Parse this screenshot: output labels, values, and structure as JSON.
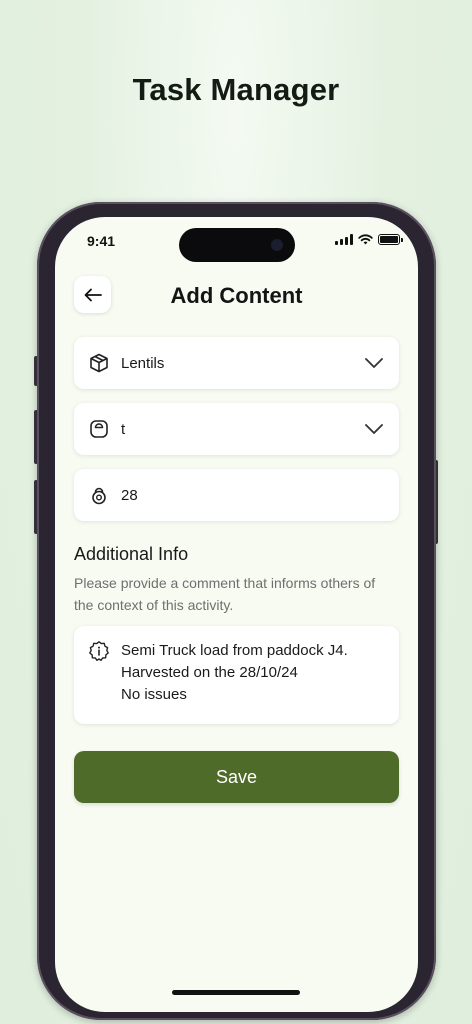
{
  "promo": {
    "title": "Task Manager"
  },
  "status_bar": {
    "time": "9:41"
  },
  "header": {
    "title": "Add Content",
    "back_icon": "arrow-left-icon"
  },
  "form": {
    "crop": {
      "icon": "box-icon",
      "value": "Lentils"
    },
    "unit": {
      "icon": "weight-icon",
      "value": "t"
    },
    "quantity": {
      "icon": "kettlebell-icon",
      "value": "28"
    }
  },
  "additional_info": {
    "title": "Additional Info",
    "subtitle": "Please provide a comment that informs others of the context of this activity.",
    "comment_lines": [
      "Semi Truck load from paddock J4.",
      "Harvested on the 28/10/24",
      "No issues"
    ],
    "comment_icon": "info-badge-icon"
  },
  "actions": {
    "save_label": "Save"
  },
  "colors": {
    "accent": "#4f6b2a",
    "screen_bg": "#f7fbf2"
  }
}
